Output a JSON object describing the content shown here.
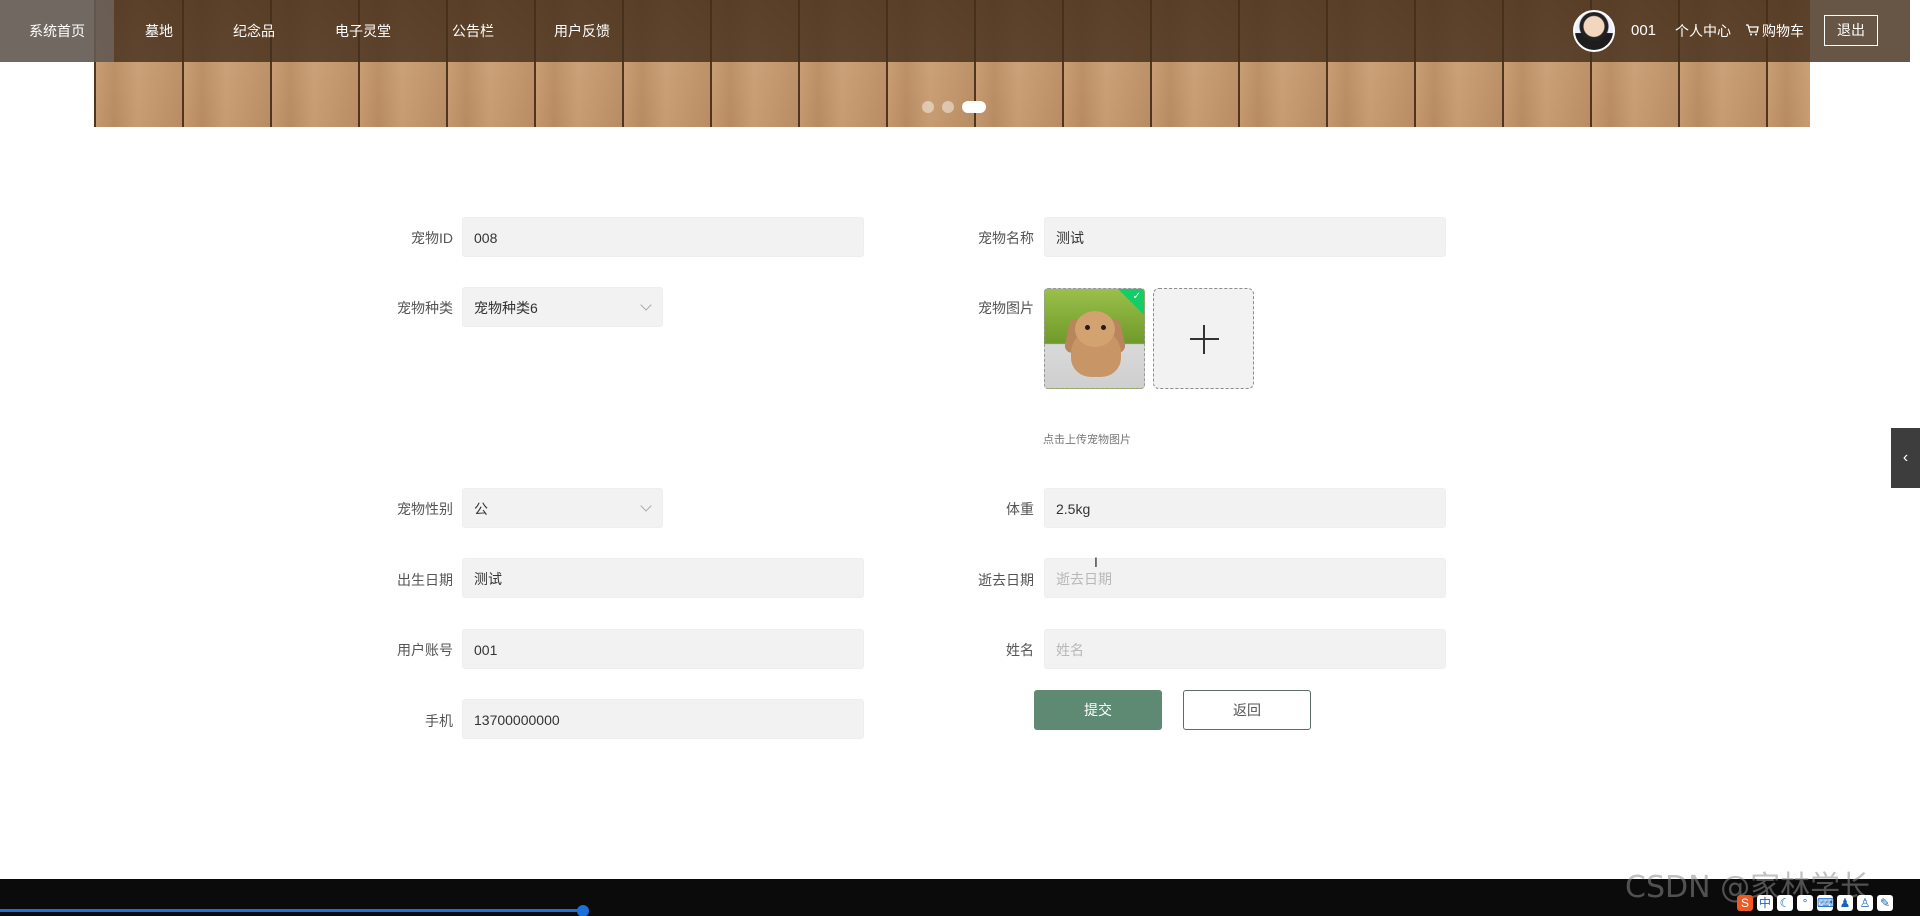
{
  "nav": {
    "items": [
      "系统首页",
      "墓地",
      "纪念品",
      "电子灵堂",
      "公告栏",
      "用户反馈"
    ],
    "username": "001",
    "user_center": "个人中心",
    "cart": "购物车",
    "logout": "退出"
  },
  "carousel": {
    "slides": 3,
    "active": 3
  },
  "form": {
    "pet_id": {
      "label": "宠物ID",
      "value": "008"
    },
    "pet_name": {
      "label": "宠物名称",
      "value": "测试"
    },
    "pet_type": {
      "label": "宠物种类",
      "value": "宠物种类6"
    },
    "pet_image": {
      "label": "宠物图片",
      "hint": "点击上传宠物图片"
    },
    "pet_gender": {
      "label": "宠物性别",
      "value": "公"
    },
    "weight": {
      "label": "体重",
      "value": "2.5kg"
    },
    "birth_date": {
      "label": "出生日期",
      "value": "测试"
    },
    "death_date": {
      "label": "逝去日期",
      "value": "",
      "placeholder": "逝去日期"
    },
    "user_account": {
      "label": "用户账号",
      "value": "001"
    },
    "name": {
      "label": "姓名",
      "value": "",
      "placeholder": "姓名"
    },
    "phone": {
      "label": "手机",
      "value": "13700000000"
    }
  },
  "buttons": {
    "submit": "提交",
    "back": "返回"
  },
  "watermark": "CSDN @家林学长",
  "tray": {
    "ime": "中"
  },
  "icons": [
    "cart-icon",
    "plus-icon",
    "chevron-down-icon",
    "chevron-left-icon",
    "check-icon"
  ]
}
